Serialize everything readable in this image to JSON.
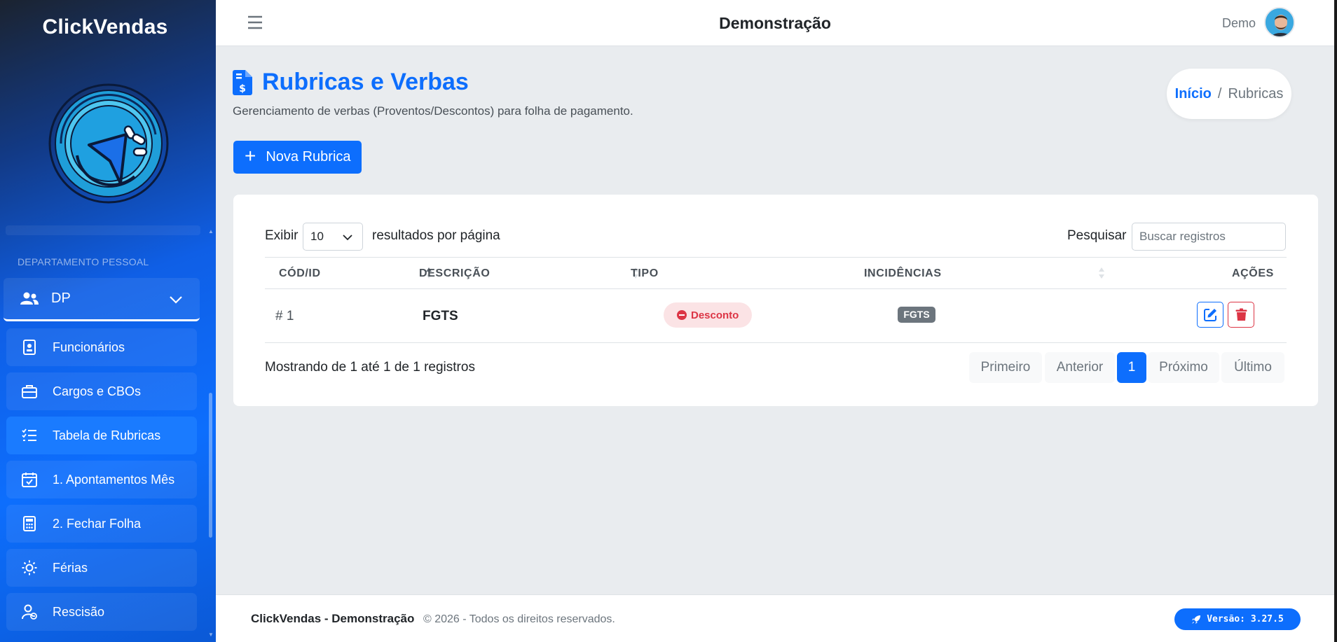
{
  "sidebar": {
    "brand": "ClickVendas",
    "section_title": "DEPARTAMENTO PESSOAL",
    "group_label": "DP",
    "items": [
      {
        "label": "Funcionários",
        "icon": "id-badge-icon"
      },
      {
        "label": "Cargos e CBOs",
        "icon": "briefcase-icon"
      },
      {
        "label": "Tabela de Rubricas",
        "icon": "list-check-icon",
        "active": true
      },
      {
        "label": "1. Apontamentos Mês",
        "icon": "calendar-check-icon"
      },
      {
        "label": "2. Fechar Folha",
        "icon": "calculator-icon"
      },
      {
        "label": "Férias",
        "icon": "sun-icon"
      },
      {
        "label": "Rescisão",
        "icon": "user-remove-icon"
      }
    ]
  },
  "topbar": {
    "title": "Demonstração",
    "user_name": "Demo"
  },
  "page": {
    "title": "Rubricas e Verbas",
    "subtitle": "Gerenciamento de verbas (Proventos/Descontos) para folha de pagamento.",
    "new_button": "Nova Rubrica"
  },
  "breadcrumb": {
    "home": "Início",
    "separator": "/",
    "current": "Rubricas"
  },
  "table": {
    "length_label_before": "Exibir",
    "length_value": "10",
    "length_label_after": "resultados por página",
    "search_label": "Pesquisar",
    "search_placeholder": "Buscar registros",
    "columns": [
      "CÓD/ID",
      "DESCRIÇÃO",
      "TIPO",
      "INCIDÊNCIAS",
      "AÇÕES"
    ],
    "rows": [
      {
        "id": "# 1",
        "descricao": "FGTS",
        "tipo": "Desconto",
        "incidencias": "FGTS"
      }
    ],
    "info": "Mostrando de 1 até 1 de 1 registros",
    "pagination": [
      "Primeiro",
      "Anterior",
      "1",
      "Próximo",
      "Último"
    ]
  },
  "footer": {
    "brand": "ClickVendas - Demonstração",
    "copyright": "© 2026  - Todos os direitos reservados.",
    "version": "Versão: 3.27.5"
  },
  "colors": {
    "primary": "#0d6efd",
    "danger": "#dc3545",
    "secondary": "#6c757d"
  }
}
